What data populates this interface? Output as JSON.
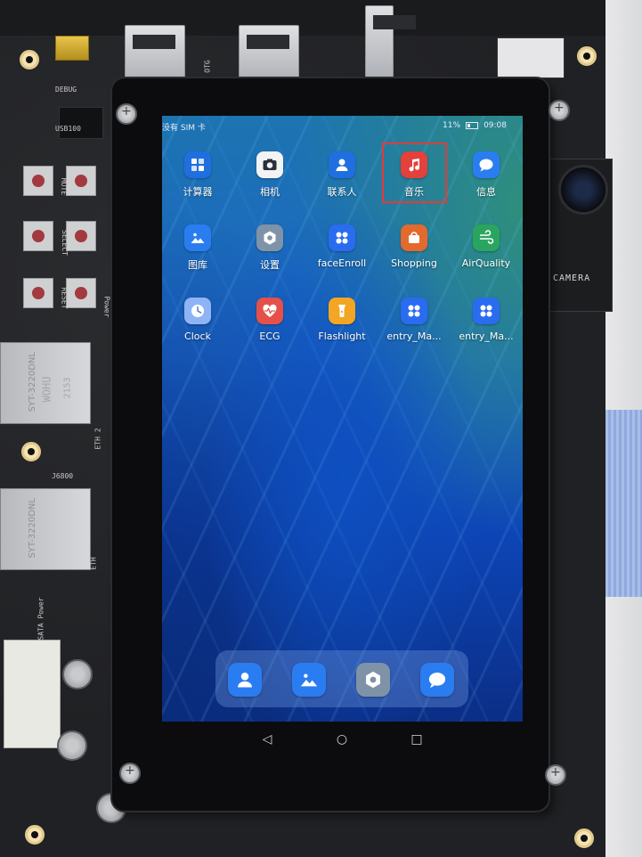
{
  "board": {
    "silk_labels": [
      "DEBUG",
      "USB100",
      "OTG",
      "MUTE",
      "SELECT",
      "RESET",
      "Power",
      "WOHU",
      "SYT-3220DNL",
      "2153",
      "ETH 2",
      "ETH",
      "SATA Power",
      "J6800",
      "CAMERA"
    ],
    "camera_label": "CAMERA"
  },
  "status": {
    "carrier": "没有 SIM 卡",
    "battery": "11%",
    "time": "09:08"
  },
  "apps": [
    {
      "label": "计算器",
      "icon": "calculator-icon",
      "color": "#1f6fe0"
    },
    {
      "label": "相机",
      "icon": "camera-icon",
      "color": "#f2f3f5"
    },
    {
      "label": "联系人",
      "icon": "contacts-icon",
      "color": "#1f6fe0"
    },
    {
      "label": "音乐",
      "icon": "music-icon",
      "color": "#e2413c"
    },
    {
      "label": "信息",
      "icon": "message-icon",
      "color": "#2a7df0"
    },
    {
      "label": "图库",
      "icon": "gallery-icon",
      "color": "#2a7df0"
    },
    {
      "label": "设置",
      "icon": "settings-icon",
      "color": "#7f93a8"
    },
    {
      "label": "faceEnroll",
      "icon": "app-grid-icon",
      "color": "#2a6cf0"
    },
    {
      "label": "Shopping",
      "icon": "shopping-icon",
      "color": "#e36a2c"
    },
    {
      "label": "AirQuality",
      "icon": "air-quality-icon",
      "color": "#2aa55f"
    },
    {
      "label": "Clock",
      "icon": "clock-icon",
      "color": "#8fb4f5"
    },
    {
      "label": "ECG",
      "icon": "ecg-icon",
      "color": "#e5504b"
    },
    {
      "label": "Flashlight",
      "icon": "flashlight-icon",
      "color": "#f2a624"
    },
    {
      "label": "entry_Ma...",
      "icon": "app-grid-icon",
      "color": "#2a6cf0"
    },
    {
      "label": "entry_Ma...",
      "icon": "app-grid-icon",
      "color": "#2a6cf0"
    }
  ],
  "highlighted_app": "音乐",
  "dock": [
    {
      "icon": "contacts-icon",
      "color": "#2a7df0"
    },
    {
      "icon": "gallery-icon",
      "color": "#2a7df0"
    },
    {
      "icon": "settings-icon",
      "color": "#7f93a8"
    },
    {
      "icon": "message-icon",
      "color": "#2a7df0"
    }
  ],
  "nav": {
    "back": "◁",
    "home": "○",
    "recents": "□"
  }
}
